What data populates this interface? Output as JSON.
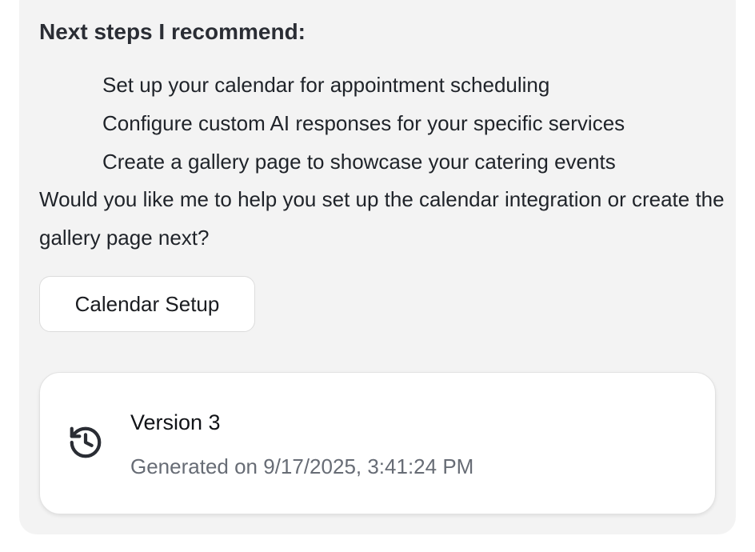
{
  "message": {
    "heading": "Next steps I recommend:",
    "steps": [
      "Set up your calendar for appointment scheduling",
      "Configure custom AI responses for your specific services",
      "Create a gallery page to showcase your catering events"
    ],
    "question": "Would you like me to help you set up the calendar integration or create the gallery page next?"
  },
  "actions": {
    "calendar_setup_label": "Calendar Setup"
  },
  "version_card": {
    "icon": "history-icon",
    "title": "Version 3",
    "subtitle": "Generated on 9/17/2025, 3:41:24 PM"
  },
  "colors": {
    "panel_background": "#f3f3f3",
    "card_background": "#ffffff",
    "muted_text": "#676c75"
  }
}
